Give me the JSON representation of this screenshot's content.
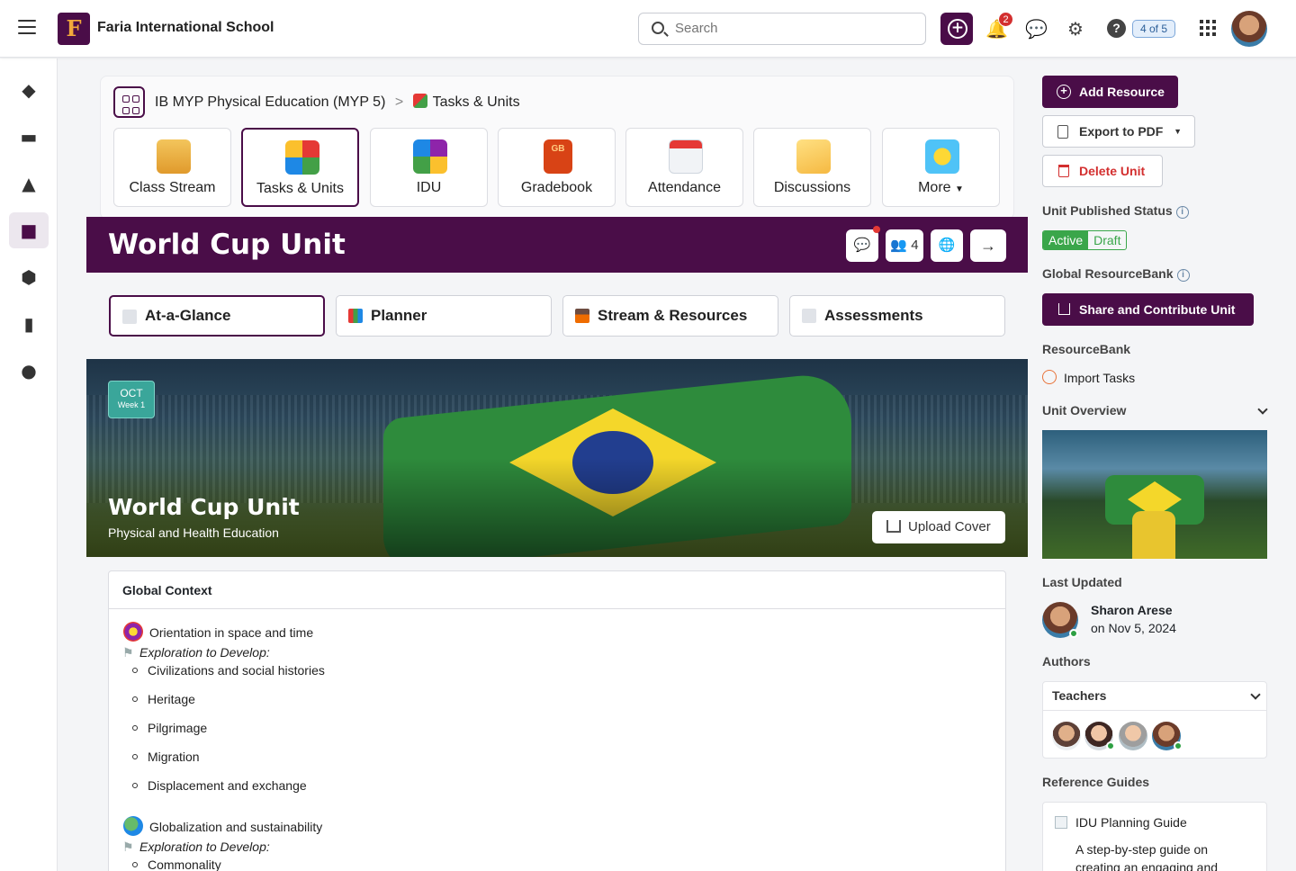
{
  "header": {
    "school_name": "Faria International School",
    "logo_letter": "F",
    "search_placeholder": "Search",
    "notification_count": "2",
    "help_label": "?",
    "pager": "4 of 5"
  },
  "breadcrumb": {
    "course": "IB MYP Physical Education (MYP 5)",
    "separator": ">",
    "current": "Tasks & Units"
  },
  "nav_tiles": [
    {
      "label": "Class Stream",
      "icon": "class-stream-icon"
    },
    {
      "label": "Tasks & Units",
      "icon": "puzzle-icon",
      "active": true
    },
    {
      "label": "IDU",
      "icon": "idu-puzzle-icon"
    },
    {
      "label": "Gradebook",
      "icon": "gradebook-icon",
      "badge": "GB"
    },
    {
      "label": "Attendance",
      "icon": "calendar-icon"
    },
    {
      "label": "Discussions",
      "icon": "envelope-icon"
    },
    {
      "label": "More",
      "icon": "lightbulb-icon",
      "has_dropdown": true
    }
  ],
  "unit": {
    "title": "World Cup Unit",
    "members_count": "4",
    "tabs": [
      {
        "label": "At-a-Glance",
        "active": true
      },
      {
        "label": "Planner"
      },
      {
        "label": "Stream & Resources"
      },
      {
        "label": "Assessments"
      }
    ],
    "banner": {
      "month": "OCT",
      "week": "Week 1",
      "title": "World Cup Unit",
      "subtitle": "Physical and Health Education",
      "upload_label": "Upload Cover"
    }
  },
  "global_context": {
    "heading": "Global Context",
    "groups": [
      {
        "title": "Orientation in space and time",
        "exploration_label": "Exploration to Develop:",
        "items": [
          "Civilizations and social histories",
          "Heritage",
          "Pilgrimage",
          "Migration",
          "Displacement and exchange"
        ]
      },
      {
        "title": "Globalization and sustainability",
        "exploration_label": "Exploration to Develop:",
        "items": [
          "Commonality"
        ]
      }
    ]
  },
  "right_panel": {
    "add_resource": "Add Resource",
    "export_pdf": "Export to PDF",
    "delete_unit": "Delete Unit",
    "published_label": "Unit Published Status",
    "status_active": "Active",
    "status_draft": "Draft",
    "resourcebank_global_label": "Global ResourceBank",
    "share_label": "Share and Contribute Unit",
    "resourcebank_label": "ResourceBank",
    "import_tasks": "Import Tasks",
    "overview_label": "Unit Overview",
    "last_updated_label": "Last Updated",
    "last_updated_name": "Sharon Arese",
    "last_updated_date": "on Nov 5, 2024",
    "authors_label": "Authors",
    "teachers_label": "Teachers",
    "reference_label": "Reference Guides",
    "guide_title": "IDU Planning Guide",
    "guide_desc": "A step-by-step guide on creating an engaging and"
  },
  "colors": {
    "brand": "#4a0d48",
    "active_status": "#3aa64a",
    "danger": "#d32f2f"
  }
}
